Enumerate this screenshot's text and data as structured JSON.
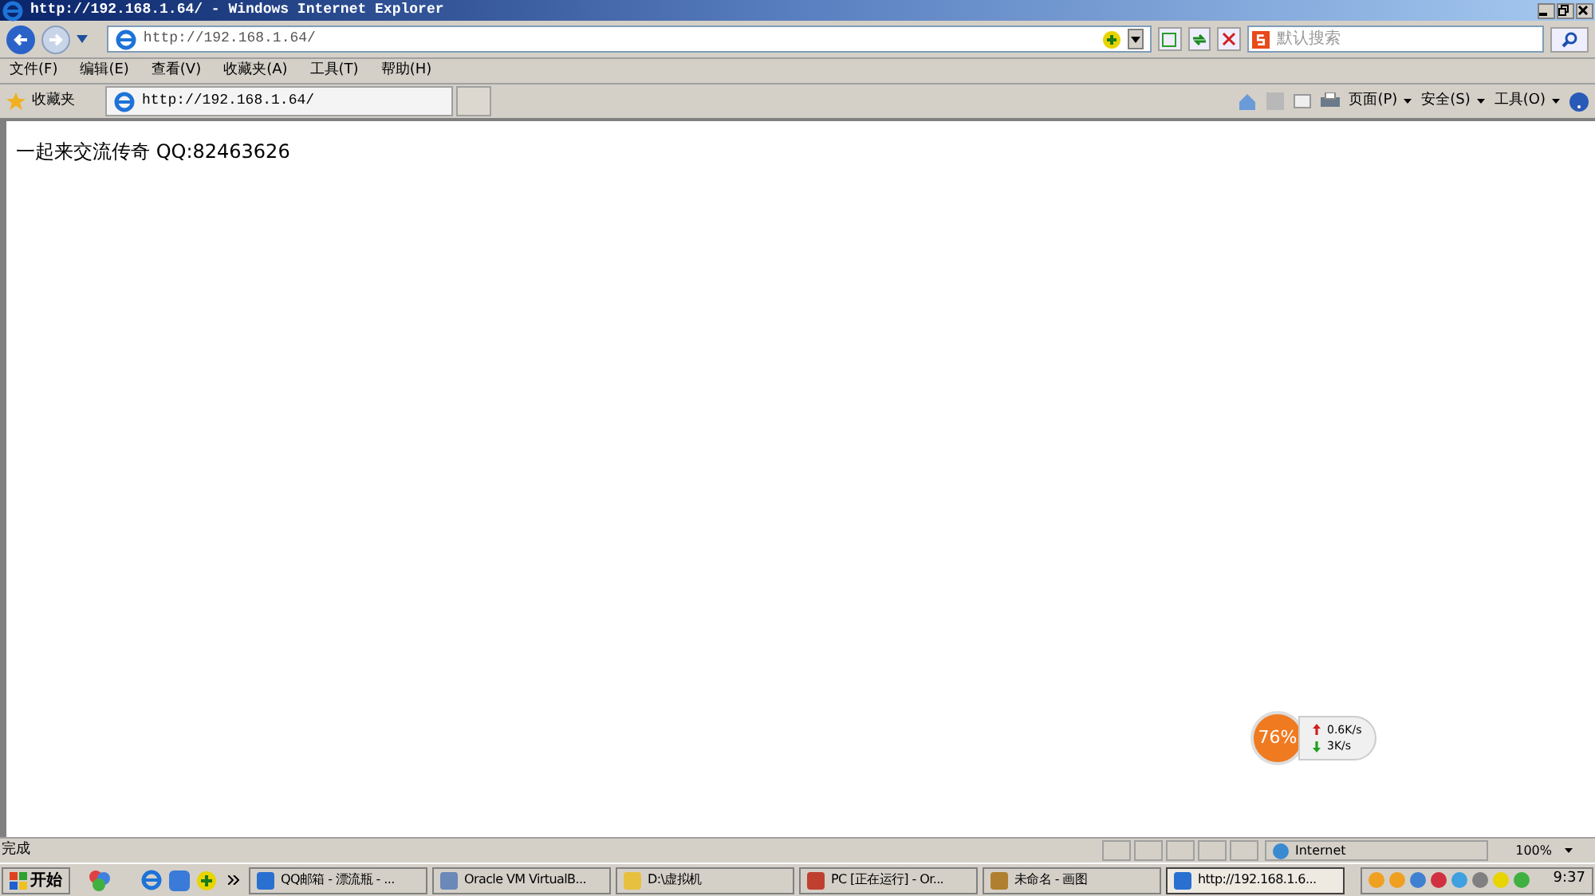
{
  "window": {
    "title": "http://192.168.1.64/ - Windows Internet Explorer"
  },
  "address_bar": {
    "value": "http://192.168.1.64/"
  },
  "search": {
    "placeholder": "默认搜索"
  },
  "menu": [
    "文件(F)",
    "编辑(E)",
    "查看(V)",
    "收藏夹(A)",
    "工具(T)",
    "帮助(H)"
  ],
  "favorites": {
    "label": "收藏夹"
  },
  "tabs": [
    {
      "label": "http://192.168.1.64/",
      "selected": true
    }
  ],
  "command_bar": [
    "页面(P)",
    "安全(S)",
    "工具(O)"
  ],
  "page": {
    "text": "一起来交流传奇 QQ:82463626"
  },
  "net_widget": {
    "percent": "76%",
    "up": "0.6K/s",
    "down": "3K/s"
  },
  "status_bar": {
    "text": "完成",
    "zone": "Internet",
    "zoom": "100%"
  },
  "taskbar": {
    "start": "开始",
    "items": [
      {
        "label": "QQ邮箱 - 漂流瓶 - ...",
        "selected": false
      },
      {
        "label": "Oracle VM VirtualB...",
        "selected": false
      },
      {
        "label": "D:\\虚拟机",
        "selected": false
      },
      {
        "label": "PC [正在运行] - Or...",
        "selected": false
      },
      {
        "label": "未命名 - 画图",
        "selected": false
      },
      {
        "label": "http://192.168.1.6...",
        "selected": true
      }
    ],
    "clock": "9:37"
  }
}
